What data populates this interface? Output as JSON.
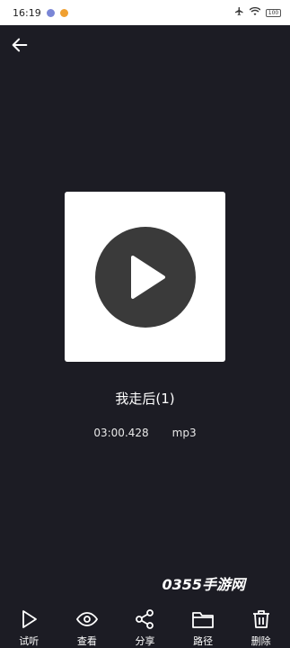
{
  "status_bar": {
    "time": "16:19",
    "battery": "100"
  },
  "track": {
    "title": "我走后(1)",
    "duration": "03:00.428",
    "format": "mp3"
  },
  "watermark": "0355手游网",
  "toolbar": [
    {
      "label": "试听",
      "icon": "play-icon"
    },
    {
      "label": "查看",
      "icon": "eye-icon"
    },
    {
      "label": "分享",
      "icon": "share-icon"
    },
    {
      "label": "路径",
      "icon": "folder-icon"
    },
    {
      "label": "删除",
      "icon": "trash-icon"
    }
  ],
  "colors": {
    "background": "#1c1c24",
    "cover_bg": "#ffffff",
    "disc": "#3a3a3a"
  }
}
